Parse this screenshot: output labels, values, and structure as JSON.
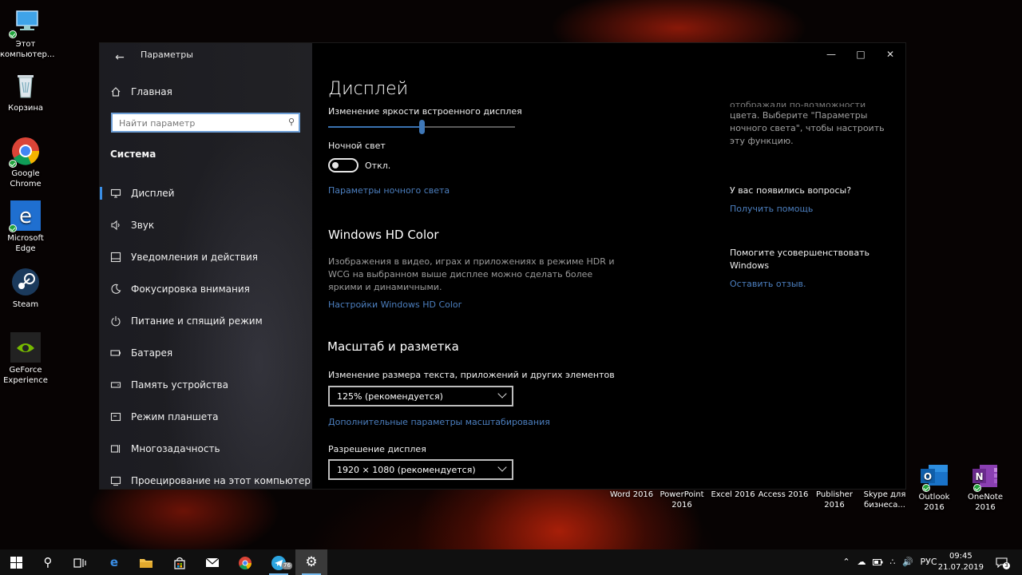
{
  "desktop": {
    "icons": [
      {
        "label1": "Этот",
        "label2": "компьютер..."
      },
      {
        "label1": "Корзина",
        "label2": ""
      },
      {
        "label1": "Google",
        "label2": "Chrome"
      },
      {
        "label1": "Microsoft",
        "label2": "Edge"
      },
      {
        "label1": "Steam",
        "label2": ""
      },
      {
        "label1": "GeForce",
        "label2": "Experience"
      }
    ],
    "apps": [
      {
        "label1": "Word 2016",
        "label2": ""
      },
      {
        "label1": "PowerPoint",
        "label2": "2016"
      },
      {
        "label1": "Excel 2016",
        "label2": ""
      },
      {
        "label1": "Access 2016",
        "label2": ""
      },
      {
        "label1": "Publisher",
        "label2": "2016"
      },
      {
        "label1": "Skype для",
        "label2": "бизнеса..."
      },
      {
        "label1": "Outlook 2016",
        "label2": ""
      },
      {
        "label1": "OneNote",
        "label2": "2016"
      }
    ]
  },
  "window": {
    "title": "Параметры",
    "home": "Главная",
    "search_placeholder": "Найти параметр",
    "section": "Система",
    "nav": [
      {
        "label": "Дисплей",
        "icon": "monitor-icon"
      },
      {
        "label": "Звук",
        "icon": "speaker-icon"
      },
      {
        "label": "Уведомления и действия",
        "icon": "notification-icon"
      },
      {
        "label": "Фокусировка внимания",
        "icon": "moon-icon"
      },
      {
        "label": "Питание и спящий режим",
        "icon": "power-icon"
      },
      {
        "label": "Батарея",
        "icon": "battery-icon"
      },
      {
        "label": "Память устройства",
        "icon": "storage-icon"
      },
      {
        "label": "Режим планшета",
        "icon": "tablet-icon"
      },
      {
        "label": "Многозадачность",
        "icon": "multitask-icon"
      },
      {
        "label": "Проецирование на этот компьютер",
        "icon": "projection-icon"
      }
    ]
  },
  "main": {
    "title": "Дисплей",
    "brightness_label": "Изменение яркости встроенного дисплея",
    "brightness_value": 0.5,
    "night_light_label": "Ночной свет",
    "night_light_state": "Откл.",
    "night_light_link": "Параметры ночного света",
    "hd_title": "Windows HD Color",
    "hd_desc": "Изображения в видео, играх и приложениях в режиме HDR и WCG на выбранном выше дисплее можно сделать более яркими и динамичными.",
    "hd_link": "Настройки Windows HD Color",
    "scale_title": "Масштаб и разметка",
    "scale_label": "Изменение размера текста, приложений и других элементов",
    "scale_value": "125% (рекомендуется)",
    "scale_link": "Дополнительные параметры масштабирования",
    "resolution_label": "Разрешение дисплея",
    "resolution_value": "1920 × 1080 (рекомендуется)"
  },
  "right": {
    "partial_top": "отображали по-возможности теплые",
    "night_hint": "цвета. Выберите \"Параметры ночного света\", чтобы настроить эту функцию.",
    "questions_title": "У вас появились вопросы?",
    "help_link": "Получить помощь",
    "improve_title": "Помогите усовершенствовать Windows",
    "feedback_link": "Оставить отзыв."
  },
  "taskbar": {
    "lang": "РУС",
    "time": "09:45",
    "date": "21.07.2019",
    "notif_count": "3",
    "telegram_badge": "76"
  }
}
